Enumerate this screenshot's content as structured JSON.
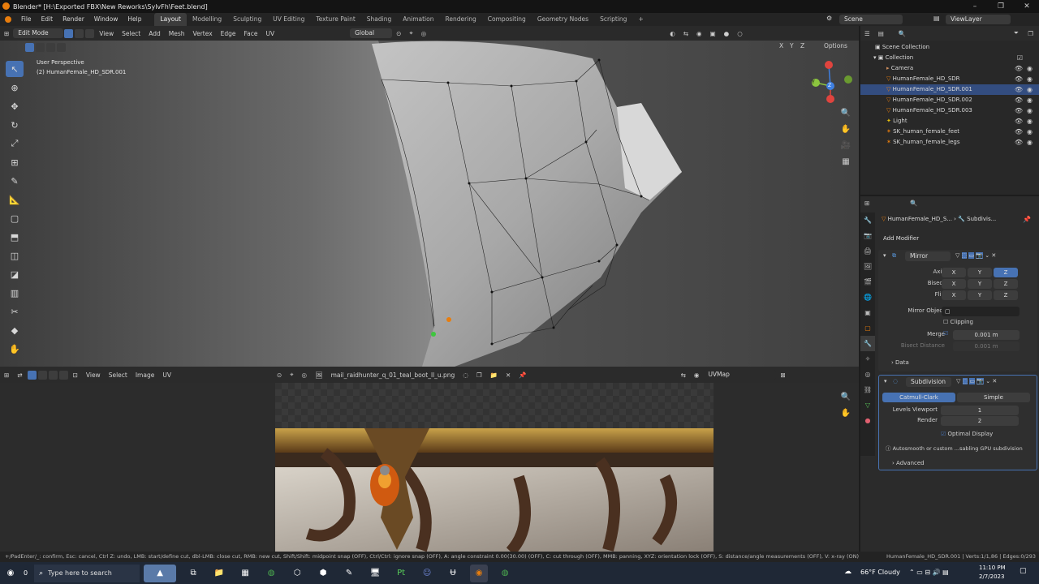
{
  "window": {
    "title": "Blender* [H:\\Exported FBX\\New Reworks\\SylvFh\\Feet.blend]",
    "controls": [
      "–",
      "❐",
      "✕"
    ]
  },
  "menubar": {
    "menus": [
      "File",
      "Edit",
      "Render",
      "Window",
      "Help"
    ],
    "workspaces": [
      "Layout",
      "Modelling",
      "Sculpting",
      "UV Editing",
      "Texture Paint",
      "Shading",
      "Animation",
      "Rendering",
      "Compositing",
      "Geometry Nodes",
      "Scripting"
    ],
    "active_workspace": "Layout",
    "add_workspace": "+",
    "scene": "Scene",
    "view_layer": "ViewLayer"
  },
  "viewport_header": {
    "mode": "Edit Mode",
    "menus": [
      "View",
      "Select",
      "Add",
      "Mesh",
      "Vertex",
      "Edge",
      "Face",
      "UV"
    ],
    "transform_orientation": "Global",
    "options": "Options",
    "axes": [
      "X",
      "Y",
      "Z"
    ]
  },
  "viewport": {
    "view_name": "User Perspective",
    "object_name": "(2) HumanFemale_HD_SDR.001"
  },
  "gizmo": {
    "x": "X",
    "y": "Y",
    "z": "Z",
    "x_color": "#e0443e",
    "y_color": "#8cc63f",
    "z_color": "#3e7fe0"
  },
  "uv_header": {
    "menus": [
      "View",
      "Select",
      "Image",
      "UV"
    ],
    "image_name": "mail_raidhunter_q_01_teal_boot_ll_u.png",
    "uv_map": "UVMap"
  },
  "outliner": {
    "root": "Scene Collection",
    "collection": "Collection",
    "items": [
      {
        "name": "Camera"
      },
      {
        "name": "HumanFemale_HD_SDR"
      },
      {
        "name": "HumanFemale_HD_SDR.001"
      },
      {
        "name": "HumanFemale_HD_SDR.002"
      },
      {
        "name": "HumanFemale_HD_SDR.003"
      },
      {
        "name": "Light"
      },
      {
        "name": "SK_human_female_feet"
      },
      {
        "name": "SK_human_female_legs"
      }
    ]
  },
  "properties": {
    "breadcrumb_object": "HumanFemale_HD_S...",
    "breadcrumb_modifier": "Subdivis...",
    "add_modifier": "Add Modifier",
    "mirror": {
      "name": "Mirror",
      "axis_label": "Axis",
      "bisect_label": "Bisect",
      "flip_label": "Flip",
      "x": "X",
      "y": "Y",
      "z": "Z",
      "mirror_object_label": "Mirror Object",
      "clipping_label": "Clipping",
      "merge_label": "Merge",
      "merge_value": "0.001 m",
      "bisect_distance_label": "Bisect Distance",
      "bisect_distance_value": "0.001 m",
      "data_label": "Data"
    },
    "subdivision": {
      "name": "Subdivision",
      "catmull": "Catmull-Clark",
      "simple": "Simple",
      "levels_viewport_label": "Levels Viewport",
      "levels_viewport_value": "1",
      "render_label": "Render",
      "render_value": "2",
      "optimal_display_label": "Optimal Display",
      "warning": "Autosmooth or custom ...sabling GPU subdivision",
      "advanced_label": "Advanced"
    }
  },
  "statusbar": {
    "hint": "+/PadEnter/_: confirm, Esc: cancel, Ctrl Z: undo, LMB: start/define cut, dbl-LMB: close cut, RMB: new cut, Shift/Shift: midpoint snap (OFF), Ctrl/Ctrl: ignore snap (OFF), A: angle constraint 0.00(30.00) (OFF), C: cut through (OFF), MMB: panning, XYZ: orientation lock (OFF), S: distance/angle measurements (OFF), V: x-ray (ON)",
    "stats": "HumanFemale_HD_SDR.001 | Verts:1/1,86 | Edges:0/293"
  },
  "taskbar": {
    "search_placeholder": "Type here to search",
    "notification_count": "0",
    "weather": "66°F  Cloudy",
    "time": "11:10 PM",
    "date": "2/7/2023"
  }
}
